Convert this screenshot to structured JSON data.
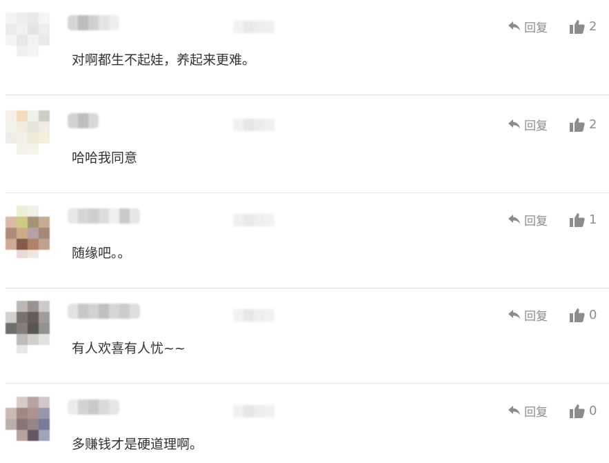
{
  "comments": [
    {
      "text": "对啊都生不起娃，养起来更难。",
      "reply_label": "回复",
      "like_count": "2",
      "reply_icon": "reply-arrow-icon",
      "like_icon": "thumbs-up-icon"
    },
    {
      "text": "哈哈我同意",
      "reply_label": "回复",
      "like_count": "2",
      "reply_icon": "reply-arrow-icon",
      "like_icon": "thumbs-up-icon"
    },
    {
      "text": "随缘吧。。",
      "reply_label": "回复",
      "like_count": "1",
      "reply_icon": "reply-arrow-icon",
      "like_icon": "thumbs-up-icon"
    },
    {
      "text": "有人欢喜有人忧~~",
      "reply_label": "回复",
      "like_count": "0",
      "reply_icon": "reply-arrow-icon",
      "like_icon": "thumbs-up-icon"
    },
    {
      "text": "多赚钱才是硬道理啊。",
      "reply_label": "回复",
      "like_count": "0",
      "reply_icon": "reply-arrow-icon",
      "like_icon": "thumbs-up-icon"
    }
  ],
  "colors": {
    "text": "#333333",
    "action": "#8c8c8c",
    "divider": "#e3e3e3"
  }
}
